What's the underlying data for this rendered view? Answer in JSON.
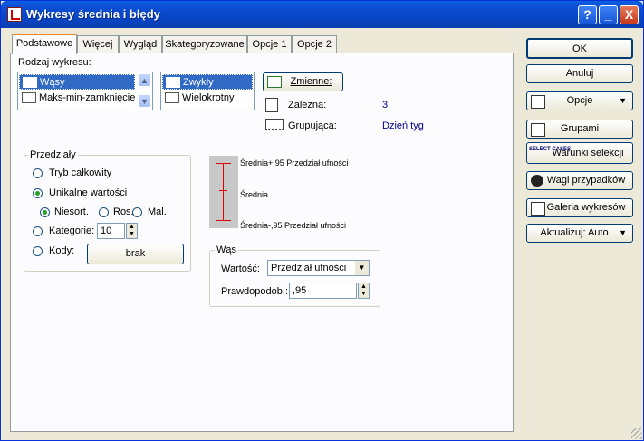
{
  "window": {
    "title": "Wykresy średnia i błędy"
  },
  "titlebar_buttons": {
    "help": "?",
    "minimize": "_",
    "close": "X"
  },
  "tabs": [
    "Podstawowe",
    "Więcej",
    "Wygląd",
    "Skategoryzowane",
    "Opcje 1",
    "Opcje 2"
  ],
  "chart_type": {
    "label": "Rodzaj wykresu:",
    "list1": [
      "Wąsy",
      "Maks-min-zamknięcie"
    ],
    "list2": [
      "Zwykły",
      "Wielokrotny"
    ]
  },
  "variables": {
    "button": "Zmienne:",
    "dependent_label": "Zależna:",
    "dependent_value": "3",
    "grouping_label": "Grupująca:",
    "grouping_value": "Dzień tyg"
  },
  "intervals": {
    "title": "Przedziały",
    "full_mode": "Tryb całkowity",
    "unique_values": "Unikalne wartości",
    "unsorted": "Niesort.",
    "ascending": "Ros.",
    "descending": "Mal.",
    "categories": "Kategorie:",
    "categories_value": "10",
    "codes": "Kody:",
    "codes_button": "brak"
  },
  "preview": {
    "upper": "Średnia+,95 Przedział ufności",
    "mean": "Średnia",
    "lower": "Średnia-,95 Przedział ufności"
  },
  "whiskers": {
    "title": "Wąs",
    "value_label": "Wartość:",
    "value_selected": "Przedział ufności",
    "probability_label": "Prawdopodob.:",
    "probability_value": ",95"
  },
  "right_buttons": {
    "ok": "OK",
    "cancel": "Anuluj",
    "options": "Opcje",
    "by_group": "Grupami",
    "select_cases": "Warunki selekcji",
    "select_icon_text": "SELECT CASES",
    "case_weights": "Wagi przypadków",
    "chart_gallery": "Galeria wykresów",
    "update": "Aktualizuj: Auto"
  },
  "colors": {
    "title_blue": "#0a5fe0",
    "selection": "#316ac5",
    "whisker_red": "#e00000",
    "value_blue": "#00008b"
  }
}
